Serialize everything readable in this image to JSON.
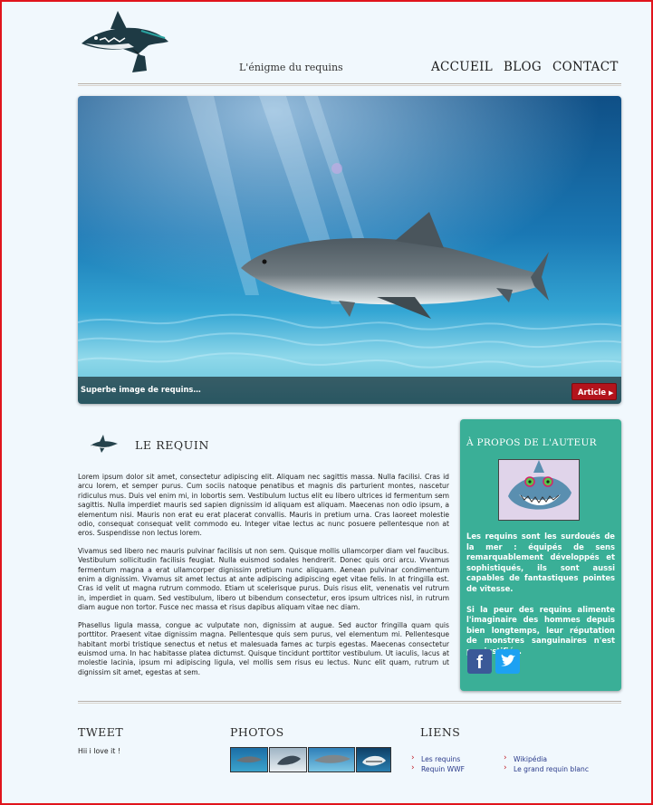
{
  "header": {
    "tagline": "L'énigme du requins",
    "nav": [
      "ACCUEIL",
      "BLOG",
      "CONTACT"
    ]
  },
  "hero": {
    "caption": "Superbe image de requins…",
    "button": "Article"
  },
  "article": {
    "title": "LE REQUIN",
    "paragraphs": [
      "Lorem ipsum dolor sit amet, consectetur adipiscing elit. Aliquam nec sagittis massa. Nulla facilisi. Cras id arcu lorem, et semper purus. Cum sociis natoque penatibus et magnis dis parturient montes, nascetur ridiculus mus. Duis vel enim mi, in lobortis sem. Vestibulum luctus elit eu libero ultrices id fermentum sem sagittis. Nulla imperdiet mauris sed sapien dignissim id aliquam est aliquam. Maecenas non odio ipsum, a elementum nisi. Mauris non erat eu erat placerat convallis. Mauris in pretium urna. Cras laoreet molestie odio, consequat consequat velit commodo eu. Integer vitae lectus ac nunc posuere pellentesque non at eros. Suspendisse non lectus lorem.",
      "Vivamus sed libero nec mauris pulvinar facilisis ut non sem. Quisque mollis ullamcorper diam vel faucibus. Vestibulum sollicitudin facilisis feugiat. Nulla euismod sodales hendrerit. Donec quis orci arcu. Vivamus fermentum magna a erat ullamcorper dignissim pretium nunc aliquam. Aenean pulvinar condimentum enim a dignissim. Vivamus sit amet lectus at ante adipiscing adipiscing eget vitae felis. In at fringilla est. Cras id velit ut magna rutrum commodo. Etiam ut scelerisque purus. Duis risus elit, venenatis vel rutrum in, imperdiet in quam. Sed vestibulum, libero ut bibendum consectetur, eros ipsum ultrices nisl, in rutrum diam augue non tortor. Fusce nec massa et risus dapibus aliquam vitae nec diam.",
      "Phasellus ligula massa, congue ac vulputate non, dignissim at augue. Sed auctor fringilla quam quis porttitor. Praesent vitae dignissim magna. Pellentesque quis sem purus, vel elementum mi. Pellentesque habitant morbi tristique senectus et netus et malesuada fames ac turpis egestas. Maecenas consectetur euismod urna. In hac habitasse platea dictumst. Quisque tincidunt porttitor vestibulum. Ut iaculis, lacus at molestie lacinia, ipsum mi adipiscing ligula, vel mollis sem risus eu lectus. Nunc elit quam, rutrum ut dignissim sit amet, egestas at sem."
    ]
  },
  "sidebar": {
    "title": "À PROPOS DE L'AUTEUR",
    "paragraphs": [
      "Les requins sont les surdoués de la mer : équipés de sens remarquablement développés et sophistiqués, ils sont aussi capables de fantastiques pointes de vitesse.",
      "Si la peur des requins alimente l'imaginaire des hommes depuis bien longtemps, leur réputation de monstres sanguinaires n'est pas justifiée."
    ],
    "social_icons": [
      "facebook-icon",
      "twitter-icon"
    ],
    "bg_color": "#3aaf97"
  },
  "footer": {
    "tweet": {
      "title": "TWEET",
      "text": "Hii i love it !"
    },
    "photos": {
      "title": "PHOTOS"
    },
    "links": {
      "title": "LIENS",
      "col1": [
        "Les requins",
        "Requin WWF"
      ],
      "col2": [
        "Wikipédia",
        "Le grand requin blanc"
      ]
    }
  },
  "colors": {
    "page_border": "#e0141c",
    "button_red": "#b3141c",
    "page_bg": "#f1f8fd"
  }
}
